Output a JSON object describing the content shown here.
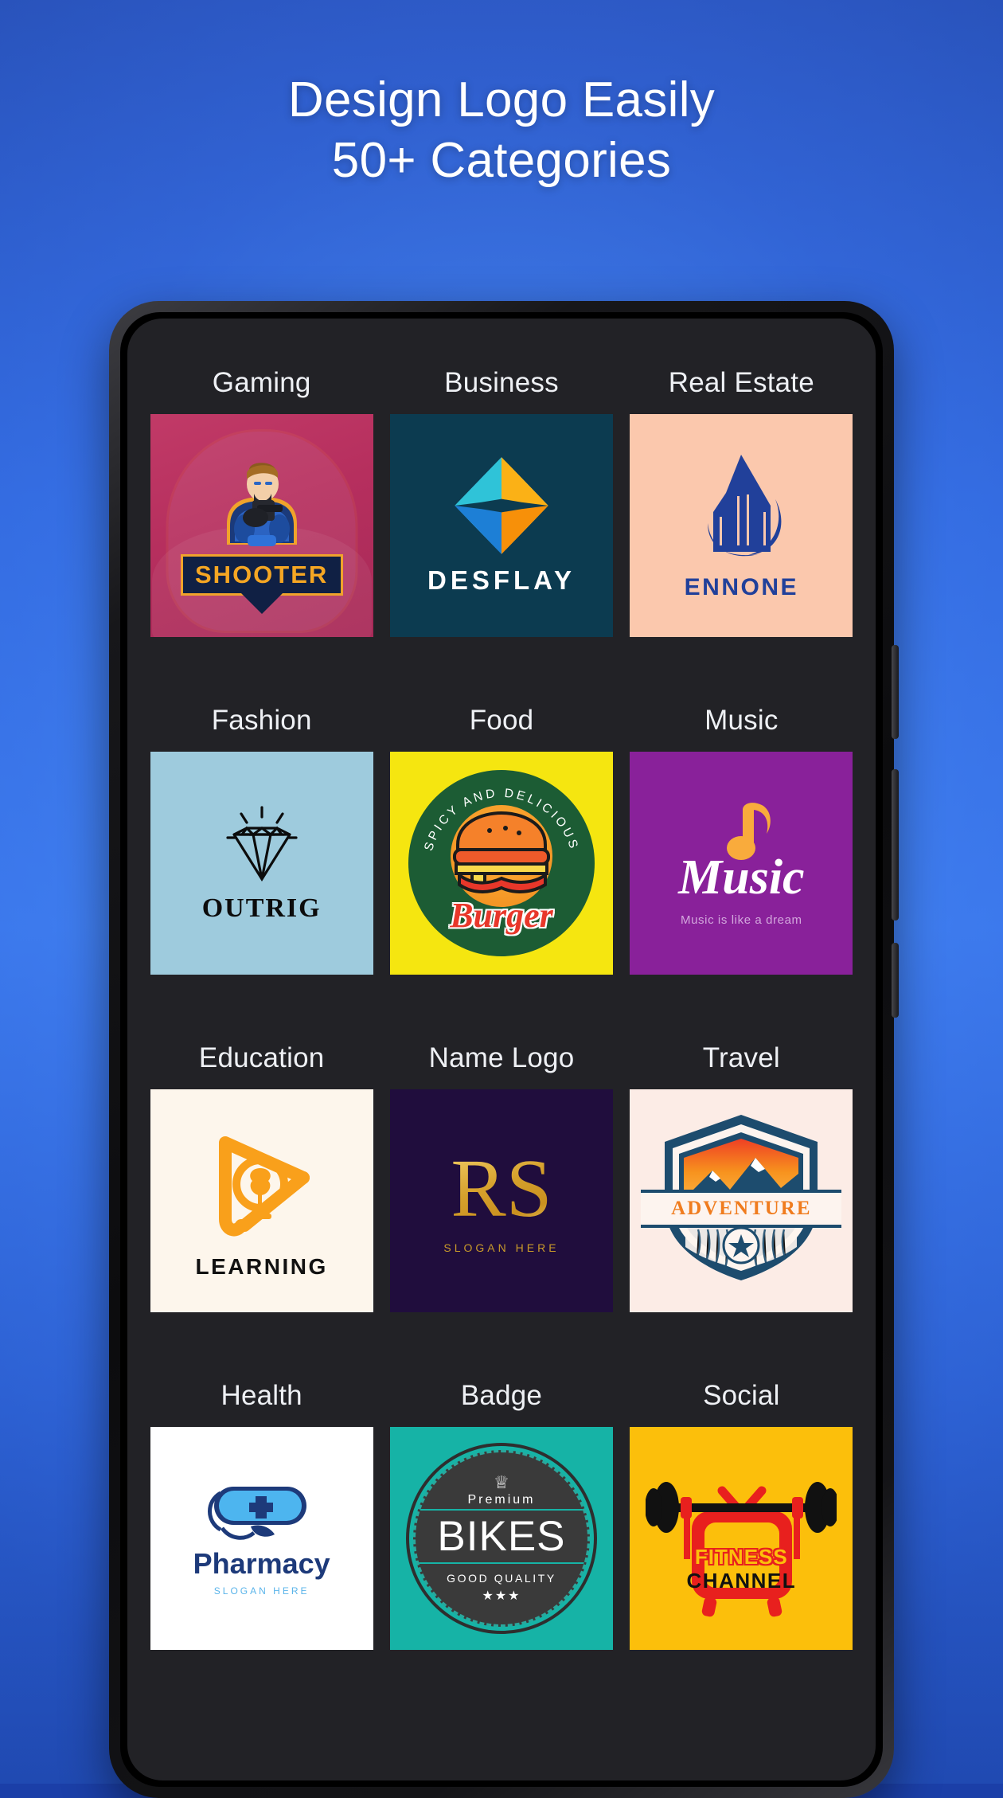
{
  "headline": {
    "line1": "Design Logo Easily",
    "line2": "50+ Categories"
  },
  "colors": {
    "background_top": "#1b3070",
    "background_mid": "#2b57d0",
    "background_bottom": "#12265f",
    "phone_frame": "#17171a",
    "screen_background": "#222226",
    "label_text": "#eef0f4"
  },
  "app_screen": {
    "rows": [
      {
        "cells": [
          {
            "category": "Gaming",
            "logo": {
              "id": "shooter",
              "title": "SHOOTER",
              "background": "#b62f5e",
              "accent": "#f5a623",
              "panel": "#102044",
              "art": "gamer-mascot-icon"
            }
          },
          {
            "category": "Business",
            "logo": {
              "id": "desflay",
              "title": "DESFLAY",
              "background": "#0c3b50",
              "accent_left": "#1ea3c9",
              "accent_right": "#f7991c",
              "art": "diamond-icon"
            }
          },
          {
            "category": "Real Estate",
            "logo": {
              "id": "ennone",
              "title": "ENNONE",
              "background": "#fbc8ad",
              "accent": "#21409a",
              "art": "skyscraper-icon"
            }
          }
        ]
      },
      {
        "cells": [
          {
            "category": "Fashion",
            "logo": {
              "id": "outrig",
              "title": "OUTRIG",
              "background": "#9ecbdd",
              "accent": "#0c0c0c",
              "art": "diamond-gem-icon"
            }
          },
          {
            "category": "Food",
            "logo": {
              "id": "burger",
              "title": "Burger",
              "arc_text": "SPICY AND DELICIOUS",
              "background": "#f5e610",
              "circle": "#1c5c34",
              "accent": "#e8372a",
              "art": "burger-icon"
            }
          },
          {
            "category": "Music",
            "logo": {
              "id": "music",
              "title": "Music",
              "tagline": "Music is like a dream",
              "background": "#89219a",
              "accent": "#f9ab3c",
              "art": "music-note-icon"
            }
          }
        ]
      },
      {
        "cells": [
          {
            "category": "Education",
            "logo": {
              "id": "learning",
              "title": "LEARNING",
              "background": "#fdf6ec",
              "accent": "#f9a01b",
              "art": "play-bulb-brain-icon"
            }
          },
          {
            "category": "Name Logo",
            "logo": {
              "id": "rs-monogram",
              "title": "RS",
              "tagline": "SLOGAN HERE",
              "background": "#200d3d",
              "accent": "#d6a12c",
              "art": "monogram-icon"
            }
          },
          {
            "category": "Travel",
            "logo": {
              "id": "adventure",
              "title": "ADVENTURE",
              "background": "#fcece6",
              "accent": "#1d4c6e",
              "accent2": "#f07c1e",
              "art": "mountain-shield-badge-icon"
            }
          }
        ]
      },
      {
        "cells": [
          {
            "category": "Health",
            "logo": {
              "id": "pharmacy",
              "title": "Pharmacy",
              "tagline": "SLOGAN HERE",
              "background": "#ffffff",
              "accent": "#1d3a7a",
              "accent2": "#4db5ef",
              "art": "pill-cross-stethoscope-icon"
            }
          },
          {
            "category": "Badge",
            "logo": {
              "id": "bikes",
              "title": "BIKES",
              "top_text": "Premium",
              "bottom_text": "GOOD QUALITY",
              "stars": "★★★",
              "crown": "♕",
              "background": "#16b3a6",
              "accent": "#3a3a3a",
              "art": "round-badge-icon"
            }
          },
          {
            "category": "Social",
            "logo": {
              "id": "fitness-channel",
              "title_line1": "FITNESS",
              "title_line2": "CHANNEL",
              "background": "#fcbf0b",
              "accent": "#e8201e",
              "art": "tv-barbell-icon"
            }
          }
        ]
      }
    ]
  }
}
